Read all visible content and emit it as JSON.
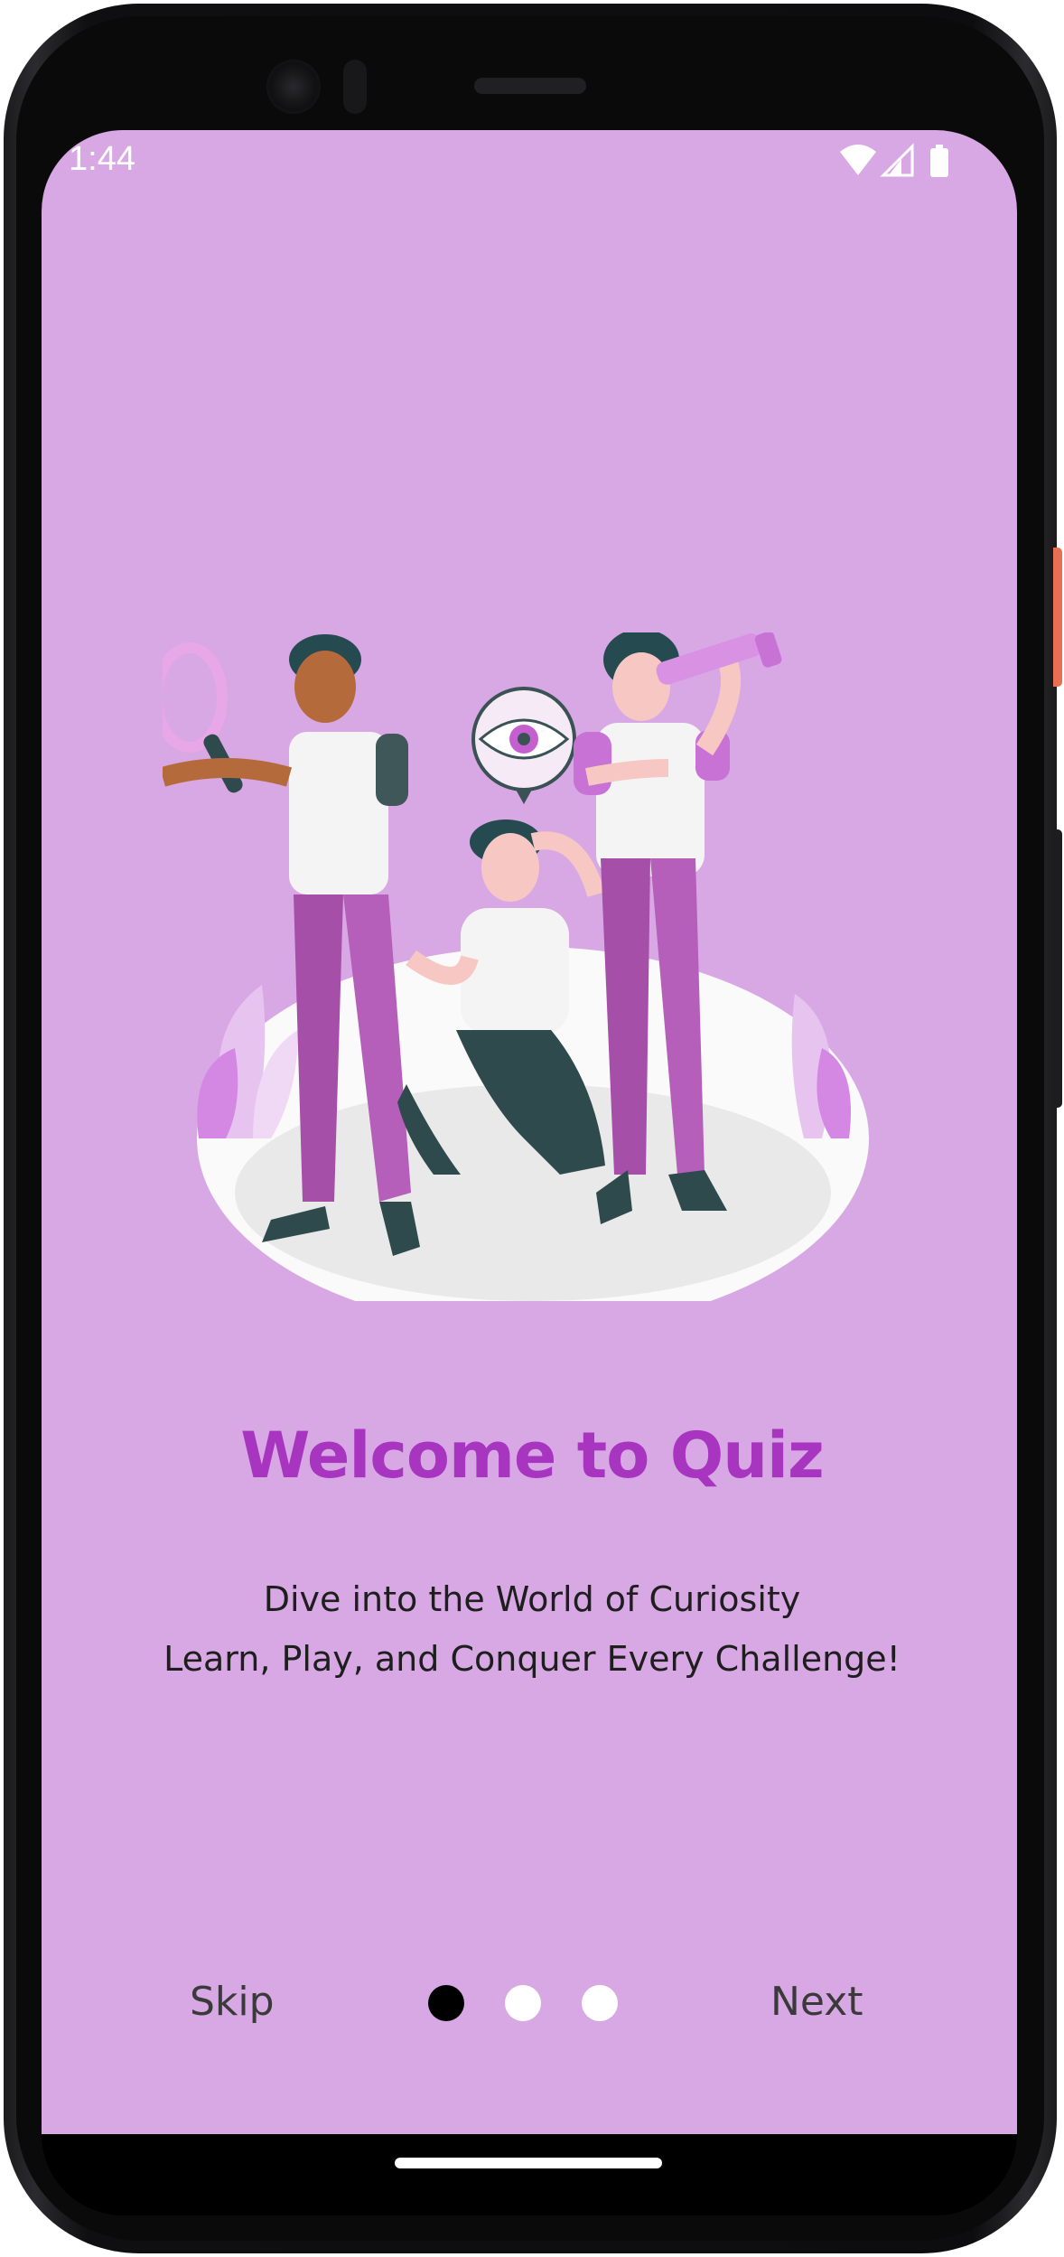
{
  "status_bar": {
    "time": "1:44",
    "icons": [
      "wifi-icon",
      "cellular-signal-icon",
      "battery-icon"
    ]
  },
  "onboarding": {
    "illustration": "people-exploring-illustration",
    "title": "Welcome to Quiz",
    "subtitle_line1": "Dive into the World of Curiosity",
    "subtitle_line2": "Learn, Play, and Conquer Every Challenge!",
    "page_indicator": {
      "total": 3,
      "current": 1
    },
    "skip_label": "Skip",
    "next_label": "Next"
  },
  "colors": {
    "background": "#d8a8e4",
    "title": "#a735c0",
    "text": "#1e1e1e",
    "dot_active": "#000000",
    "dot_inactive": "#ffffff"
  }
}
